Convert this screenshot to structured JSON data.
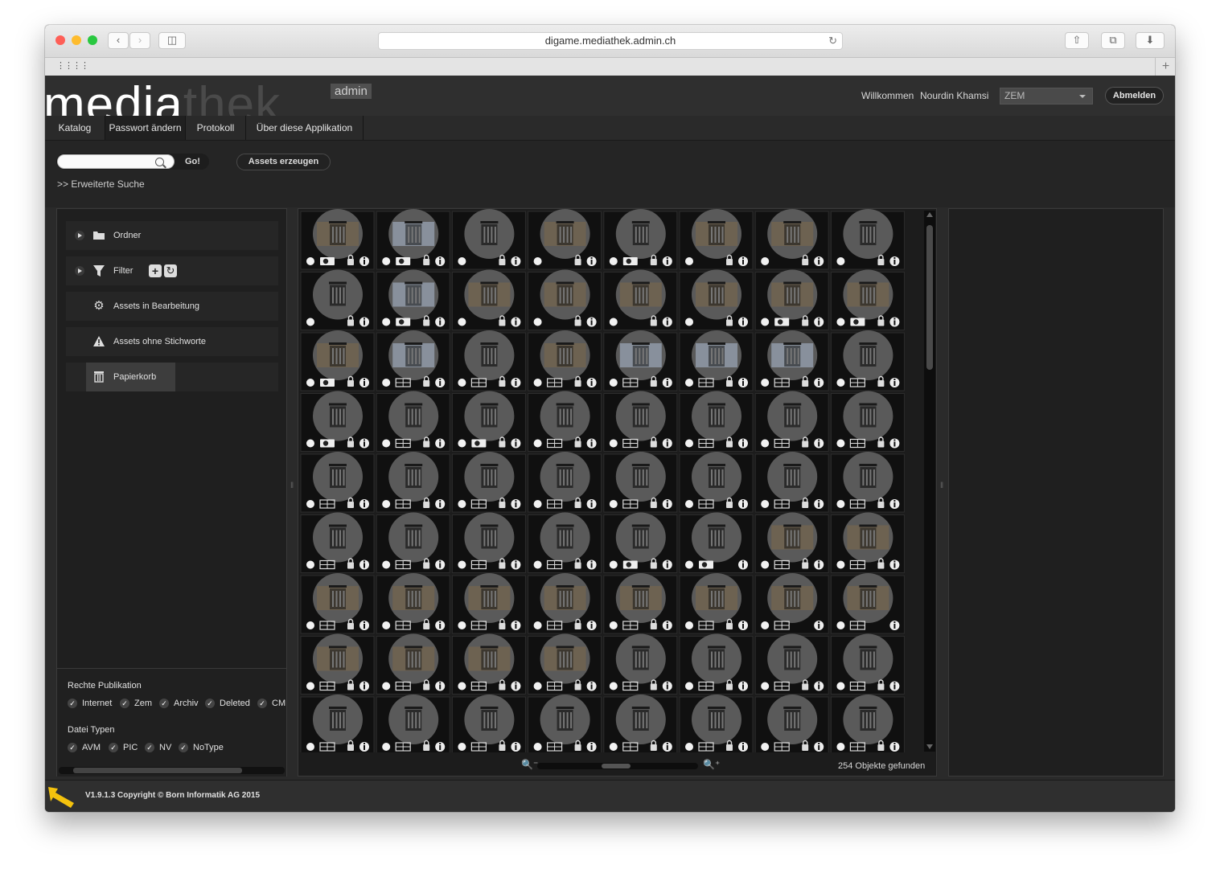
{
  "browser": {
    "url": "digame.mediathek.admin.ch",
    "traffic_lights": [
      "#fe5f57",
      "#febc2e",
      "#29c840"
    ]
  },
  "header": {
    "logo_part1": "media",
    "logo_part2": "thek",
    "logo_tag": "admin",
    "welcome": "Willkommen",
    "user": "Nourdin Khamsi",
    "select_value": "ZEM",
    "logout": "Abmelden"
  },
  "nav": {
    "tabs": [
      {
        "label": "Katalog"
      },
      {
        "label": "Passwort ändern"
      },
      {
        "label": "Protokoll"
      },
      {
        "label": "Über diese Applikation"
      }
    ]
  },
  "search": {
    "placeholder": "",
    "go": "Go!",
    "create_assets": "Assets erzeugen",
    "advanced": ">> Erweiterte Suche"
  },
  "sidebar": {
    "items": [
      {
        "label": "Ordner",
        "icon": "folder-icon"
      },
      {
        "label": "Filter",
        "icon": "filter-icon"
      },
      {
        "label": "Assets in Bearbeitung",
        "icon": "gears-icon"
      },
      {
        "label": "Assets ohne Stichworte",
        "icon": "warning-icon"
      },
      {
        "label": "Papierkorb",
        "icon": "trash-icon"
      }
    ],
    "rights_title": "Rechte Publikation",
    "rights": [
      "Internet",
      "Zem",
      "Archiv",
      "Deleted",
      "CM"
    ],
    "types_title": "Datei Typen",
    "types": [
      "AVM",
      "PIC",
      "NV",
      "NoType"
    ]
  },
  "grid": {
    "columns": 8,
    "rows": 9,
    "photo_cells": [
      0,
      1,
      3,
      5,
      6,
      9,
      10,
      11,
      12,
      13,
      14,
      15,
      16,
      17,
      19,
      20,
      21,
      22,
      46,
      47,
      48,
      49,
      50,
      51,
      52,
      53,
      54,
      55,
      56,
      57,
      58,
      59
    ],
    "bright_cells": [
      1,
      9,
      17,
      20,
      21,
      22
    ]
  },
  "status": {
    "count": "254 Objekte gefunden"
  },
  "footer": {
    "version": "V1.9.1.3 Copyright © Born Informatik AG 2015"
  },
  "colors": {
    "accent_yellow": "#f4c20d",
    "background": "#2a2a2a"
  }
}
